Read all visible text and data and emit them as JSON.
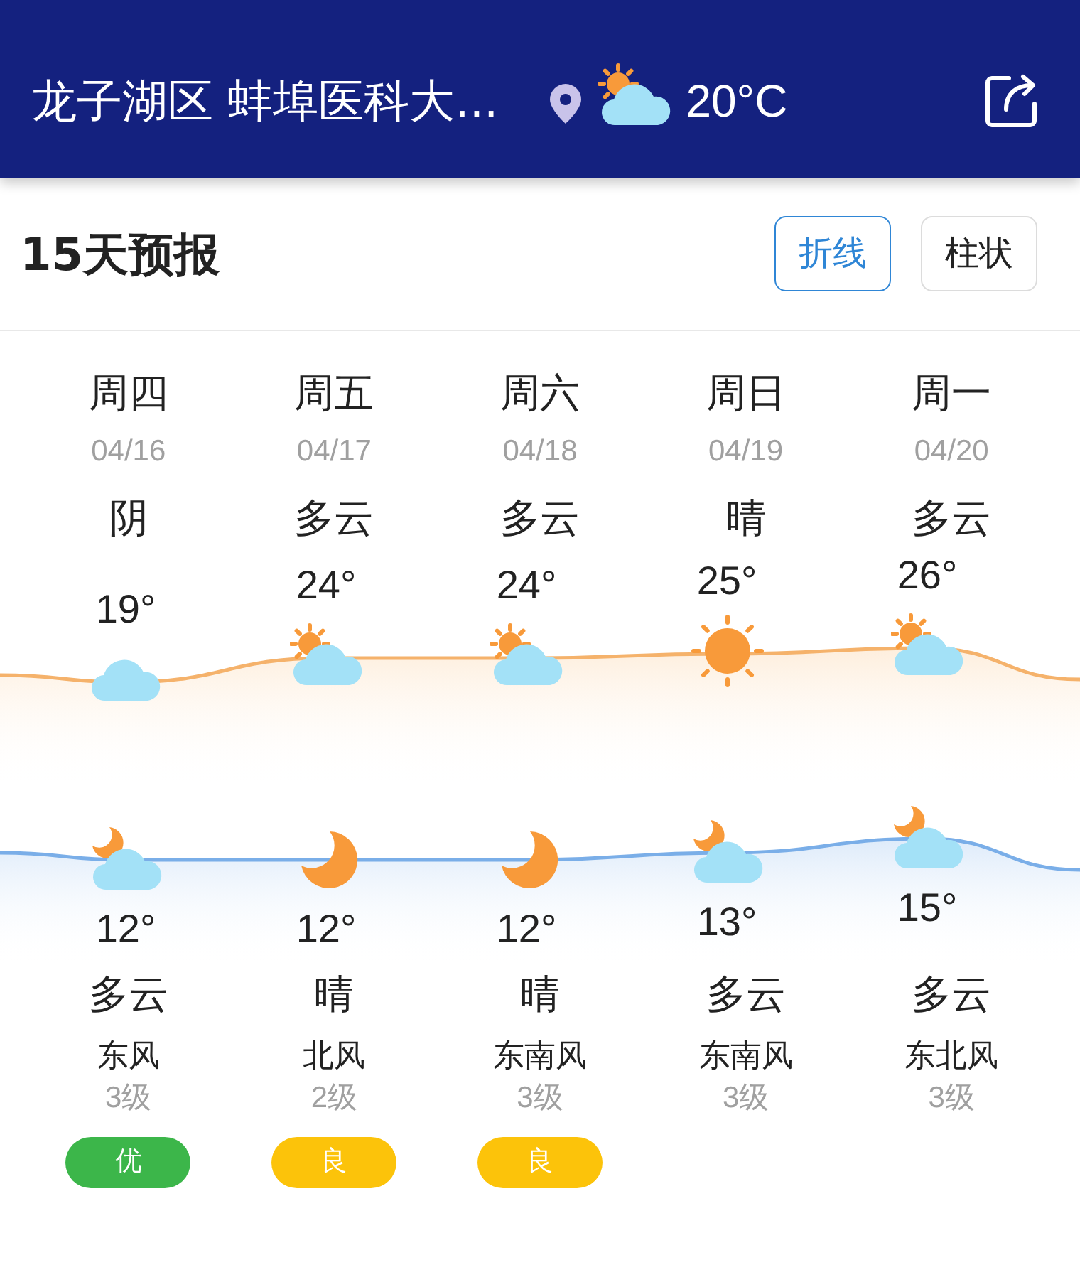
{
  "header": {
    "title": "龙子湖区 蚌埠医科大...",
    "temperature": "20°C"
  },
  "section": {
    "title": "15天预报",
    "toggles": [
      {
        "label": "折线",
        "selected": true
      },
      {
        "label": "柱状",
        "selected": false
      }
    ]
  },
  "days": [
    {
      "weekday": "周四",
      "date": "04/16",
      "day_condition": "阴",
      "day_icon": {
        "kind": "cloud"
      },
      "high": "19°",
      "low": "12°",
      "night_icon": {
        "kind": "partly"
      },
      "night_condition": "多云",
      "wind": "东风",
      "wind_level": "3级",
      "aqi": {
        "label": "优",
        "color": "#3cb64a"
      }
    },
    {
      "weekday": "周五",
      "date": "04/17",
      "day_condition": "多云",
      "day_icon": {
        "kind": "partly"
      },
      "high": "24°",
      "low": "12°",
      "night_icon": {
        "kind": "moon"
      },
      "night_condition": "晴",
      "wind": "北风",
      "wind_level": "2级",
      "aqi": {
        "label": "良",
        "color": "#fcc30a"
      }
    },
    {
      "weekday": "周六",
      "date": "04/18",
      "day_condition": "多云",
      "day_icon": {
        "kind": "partly"
      },
      "high": "24°",
      "low": "12°",
      "night_icon": {
        "kind": "moon"
      },
      "night_condition": "晴",
      "wind": "东南风",
      "wind_level": "3级",
      "aqi": {
        "label": "良",
        "color": "#fcc30a"
      }
    },
    {
      "weekday": "周日",
      "date": "04/19",
      "day_condition": "晴",
      "day_icon": {
        "kind": "sun"
      },
      "high": "25°",
      "low": "13°",
      "night_icon": {
        "kind": "partly"
      },
      "night_condition": "多云",
      "wind": "东南风",
      "wind_level": "3级"
    },
    {
      "weekday": "周一",
      "date": "04/20",
      "day_condition": "多云",
      "day_icon": {
        "kind": "partly"
      },
      "high": "26°",
      "low": "15°",
      "night_icon": {
        "kind": "partly"
      },
      "night_condition": "多云",
      "wind": "东北风",
      "wind_level": "3级"
    }
  ]
}
